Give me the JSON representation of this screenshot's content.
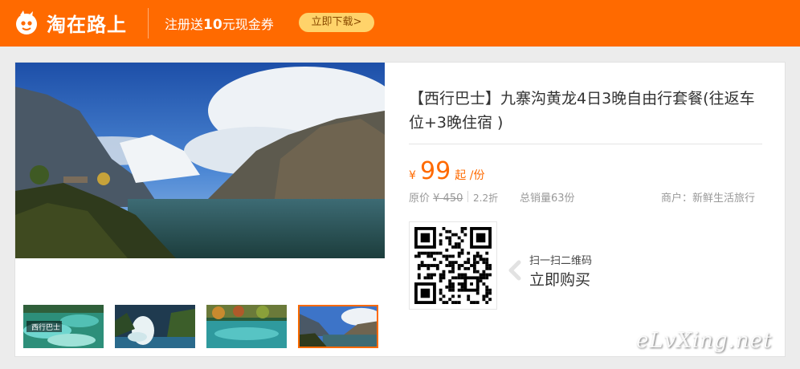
{
  "header": {
    "brand": "淘在路上",
    "promo_prefix": "注册送",
    "promo_amount": "10",
    "promo_suffix": "元现金券",
    "download_button": "立即下载>"
  },
  "product": {
    "title": "【西行巴士】九寨沟黄龙4日3晚自由行套餐(往返车位+3晚住宿 )",
    "currency": "¥",
    "price": "99",
    "price_unit": "起 /份",
    "original_label": "原价",
    "original_price": "¥ 450",
    "discount": "2.2折",
    "sales": "总销量63份",
    "merchant": "商户：新鲜生活旅行",
    "thumb_caption": "西行巴士"
  },
  "purchase": {
    "scan_hint": "扫一扫二维码",
    "buy_now": "立即购买"
  },
  "watermark": "eLvXing.net",
  "colors": {
    "brand_orange": "#ff6a00",
    "button_yellow": "#ffd36a",
    "text_dark": "#333333",
    "text_muted": "#999999"
  }
}
